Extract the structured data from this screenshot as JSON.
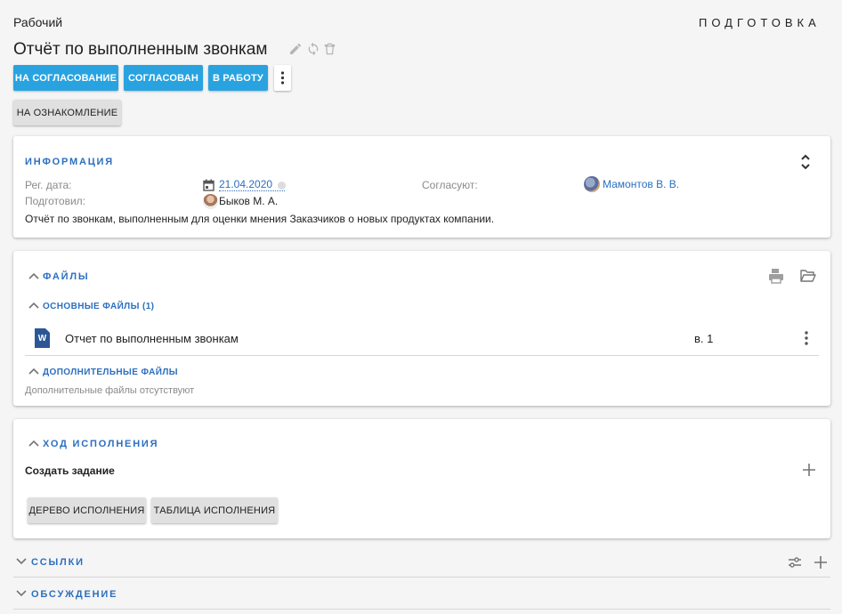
{
  "header": {
    "workspace": "Рабочий",
    "status": "ПОДГОТОВКА",
    "title": "Отчёт по выполненным звонкам"
  },
  "actions": {
    "to_approval": "НА СОГЛАСОВАНИЕ",
    "approved": "СОГЛАСОВАН",
    "to_work": "В РАБОТУ",
    "to_review": "НА ОЗНАКОМЛЕНИЕ"
  },
  "info": {
    "title": "ИНФОРМАЦИЯ",
    "reg_date_label": "Рег. дата:",
    "reg_date_value": "21.04.2020",
    "approvers_label": "Согласуют:",
    "approver_name": "Мамонтов В. В.",
    "prepared_label": "Подготовил:",
    "prepared_name": "Быков М. А.",
    "description": "Отчёт по звонкам, выполненным для оценки мнения Заказчиков о новых продуктах компании."
  },
  "files": {
    "title": "ФАЙЛЫ",
    "main_title": "ОСНОВНЫЕ ФАЙЛЫ (1)",
    "main_items": [
      {
        "name": "Отчет по выполненным звонкам",
        "version": "в. 1",
        "icon_letter": "W"
      }
    ],
    "extra_title": "ДОПОЛНИТЕЛЬНЫЕ ФАЙЛЫ",
    "extra_empty": "Дополнительные файлы отсутствуют"
  },
  "progress": {
    "title": "ХОД ИСПОЛНЕНИЯ",
    "create_task": "Создать задание",
    "tree_button": "ДЕРЕВО ИСПОЛНЕНИЯ",
    "table_button": "ТАБЛИЦА ИСПОЛНЕНИЯ"
  },
  "links": {
    "title": "ССЫЛКИ"
  },
  "discussion": {
    "title": "ОБСУЖДЕНИЕ"
  },
  "colors": {
    "accent_blue": "#29a3e0",
    "link_blue": "#2b6fc0",
    "word_blue": "#2b5797"
  }
}
